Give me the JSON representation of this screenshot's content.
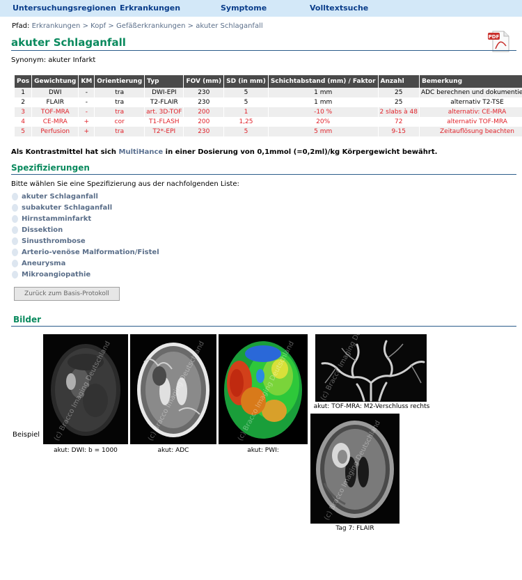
{
  "nav": {
    "items": [
      "Untersuchungsregionen",
      "Erkrankungen",
      "Symptome",
      "Volltextsuche"
    ]
  },
  "breadcrumb": {
    "label": "Pfad:",
    "items": [
      "Erkrankungen",
      "Kopf",
      "Gefäßerkrankungen",
      "akuter Schlaganfall"
    ],
    "separator": ">"
  },
  "page": {
    "title": "akuter Schlaganfall",
    "synonym": "Synonym: akuter Infarkt",
    "pdf_icon": "pdf-document-icon",
    "pdf_label": "PDF"
  },
  "protocol": {
    "headers": [
      "Pos",
      "Gewichtung",
      "KM",
      "Orientierung",
      "Typ",
      "FOV (mm)",
      "SD (in mm)",
      "Schichtabstand (mm) / Faktor",
      "Anzahl",
      "Bemerkung"
    ],
    "rows": [
      [
        "1",
        "DWI",
        "-",
        "tra",
        "DWI-EPI",
        "230",
        "5",
        "1 mm",
        "25",
        "ADC berechnen und dokumentieren"
      ],
      [
        "2",
        "FLAIR",
        "-",
        "tra",
        "T2-FLAIR",
        "230",
        "5",
        "1 mm",
        "25",
        "alternativ T2-TSE"
      ],
      [
        "3",
        "TOF-MRA",
        "-",
        "tra",
        "art. 3D-TOF",
        "200",
        "1",
        "-10 %",
        "2 slabs à 48",
        "alternativ: CE-MRA"
      ],
      [
        "4",
        "CE-MRA",
        "+",
        "cor",
        "T1-FLASH",
        "200",
        "1,25",
        "20%",
        "72",
        "alternativ TOF-MRA"
      ],
      [
        "5",
        "Perfusion",
        "+",
        "tra",
        "T2*-EPI",
        "230",
        "5",
        "5 mm",
        "9-15",
        "Zeitauflösung beachten"
      ]
    ],
    "highlight_color": "#e0222a"
  },
  "contrast": {
    "before": "Als Kontrastmittel hat sich ",
    "agent": "MultiHance",
    "after": " in einer Dosierung von 0,1mmol (=0,2ml)/kg Körpergewicht bewährt."
  },
  "spec": {
    "heading": "Spezifizierungen",
    "intro": "Bitte wählen Sie eine Spezifizierung aus der nachfolgenden Liste:",
    "items": [
      "akuter Schlaganfall",
      "subakuter Schlaganfall",
      "Hirnstamminfarkt",
      "Dissektion",
      "Sinusthrombose",
      "Arterio-venöse Malformation/Fistel",
      "Aneurysma",
      "Mikroangiopathie"
    ],
    "back_button": "Zurück zum Basis-Protokoll"
  },
  "images": {
    "heading": "Bilder",
    "row_label": "Beispiel",
    "watermark": "(c) Bracco Imaging Deutschland",
    "captions": [
      "akut: DWI: b = 1000",
      "akut: ADC",
      "akut: PWI:",
      "akut: TOF-MRA: M2-Verschluss rechts",
      "Tag 7: FLAIR"
    ]
  },
  "colors": {
    "nav_bg": "#d3e8f8",
    "nav_text": "#0a3d8a",
    "heading_green": "#0a8a5e",
    "link": "#5a6e89",
    "table_header": "#4a4a4a"
  }
}
